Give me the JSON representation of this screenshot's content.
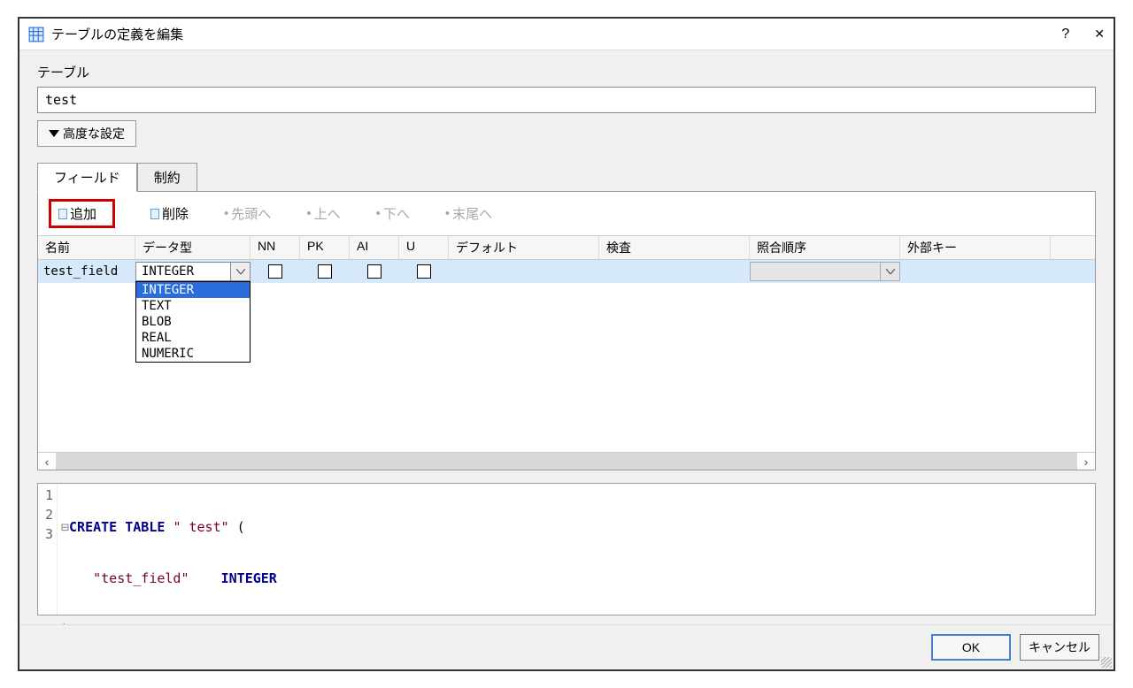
{
  "title": "テーブルの定義を編集",
  "help_symbol": "?",
  "close_symbol": "✕",
  "section_label": "テーブル",
  "table_name": "test",
  "advanced_settings": "高度な設定",
  "tabs": {
    "fields": "フィールド",
    "constraints": "制約"
  },
  "toolbar": {
    "add": "追加",
    "remove": "削除",
    "top": "先頭へ",
    "up": "上へ",
    "down": "下へ",
    "bottom": "末尾へ"
  },
  "columns": {
    "name": "名前",
    "datatype": "データ型",
    "nn": "NN",
    "pk": "PK",
    "ai": "AI",
    "u": "U",
    "default": "デフォルト",
    "check": "検査",
    "collation": "照合順序",
    "foreign": "外部キー"
  },
  "row": {
    "name": "test_field",
    "datatype": "INTEGER"
  },
  "datatype_options": [
    "INTEGER",
    "TEXT",
    "BLOB",
    "REAL",
    "NUMERIC"
  ],
  "sql": {
    "line1": {
      "fold": "⊟",
      "kw1": "CREATE",
      "kw2": "TABLE",
      "sp": " ",
      "q1": "\"",
      "name": " test",
      "q2": "\"",
      "op": " ("
    },
    "line2": {
      "indent": "    ",
      "fq1": "\"",
      "fname": "test_field",
      "fq2": "\"",
      "gap": "    ",
      "type": "INTEGER"
    },
    "line3": ");",
    "gutter": [
      "1",
      "2",
      "3"
    ]
  },
  "buttons": {
    "ok": "OK",
    "cancel": "キャンセル"
  }
}
